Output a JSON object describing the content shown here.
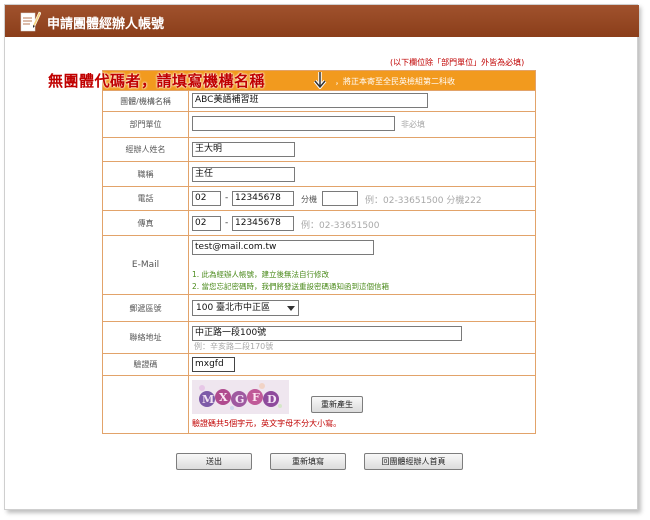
{
  "header": {
    "title": "申請團體經辦人帳號",
    "icon": "document-pencil-icon"
  },
  "top_note": "(以下欄位除「部門單位」外皆為必填)",
  "annotation": {
    "text": "無團體代碼者，請填寫機構名稱",
    "arrow": "arrow-down-icon"
  },
  "orange_bar": "，將正本寄至全民英檢組第二科收",
  "form": {
    "org_name": {
      "label": "團體/機構名稱",
      "value": "ABC美語補習班"
    },
    "department": {
      "label": "部門單位",
      "value": "",
      "hint": "非必填"
    },
    "agent_name": {
      "label": "經辦人姓名",
      "value": "王大明"
    },
    "job_title": {
      "label": "職稱",
      "value": "主任"
    },
    "phone": {
      "label": "電話",
      "area": "02",
      "number": "12345678",
      "ext_label": "分機",
      "ext": "",
      "hint": "例：02-33651500 分機222"
    },
    "fax": {
      "label": "傳真",
      "area": "02",
      "number": "12345678",
      "hint": "例：02-33651500"
    },
    "email": {
      "label": "E-Mail",
      "value": "test@mail.com.tw",
      "note1": "1. 此為經辦人帳號，建立後無法自行修改",
      "note2": "2. 當您忘記密碼時，我們將發送重設密碼通知函到這個信箱"
    },
    "zip": {
      "label": "郵遞區號",
      "value": "100 臺北市中正區"
    },
    "address": {
      "label": "聯絡地址",
      "value": "中正路一段100號",
      "hint": "例：辛亥路二段170號"
    },
    "captcha": {
      "label": "驗證碼",
      "value": "mxgfd",
      "image_text": "MXGFD",
      "regen_label": "重新產生",
      "note": "驗證碼共5個字元，英文字母不分大小寫。"
    }
  },
  "buttons": {
    "submit": "送出",
    "reset": "重新填寫",
    "back": "回團體經辦人首頁"
  },
  "colors": {
    "title_bar": "#8b3e1a",
    "orange_bar": "#f29a1e",
    "border": "#e2a36a",
    "red": "#c00000",
    "green": "#4a8a1a"
  }
}
